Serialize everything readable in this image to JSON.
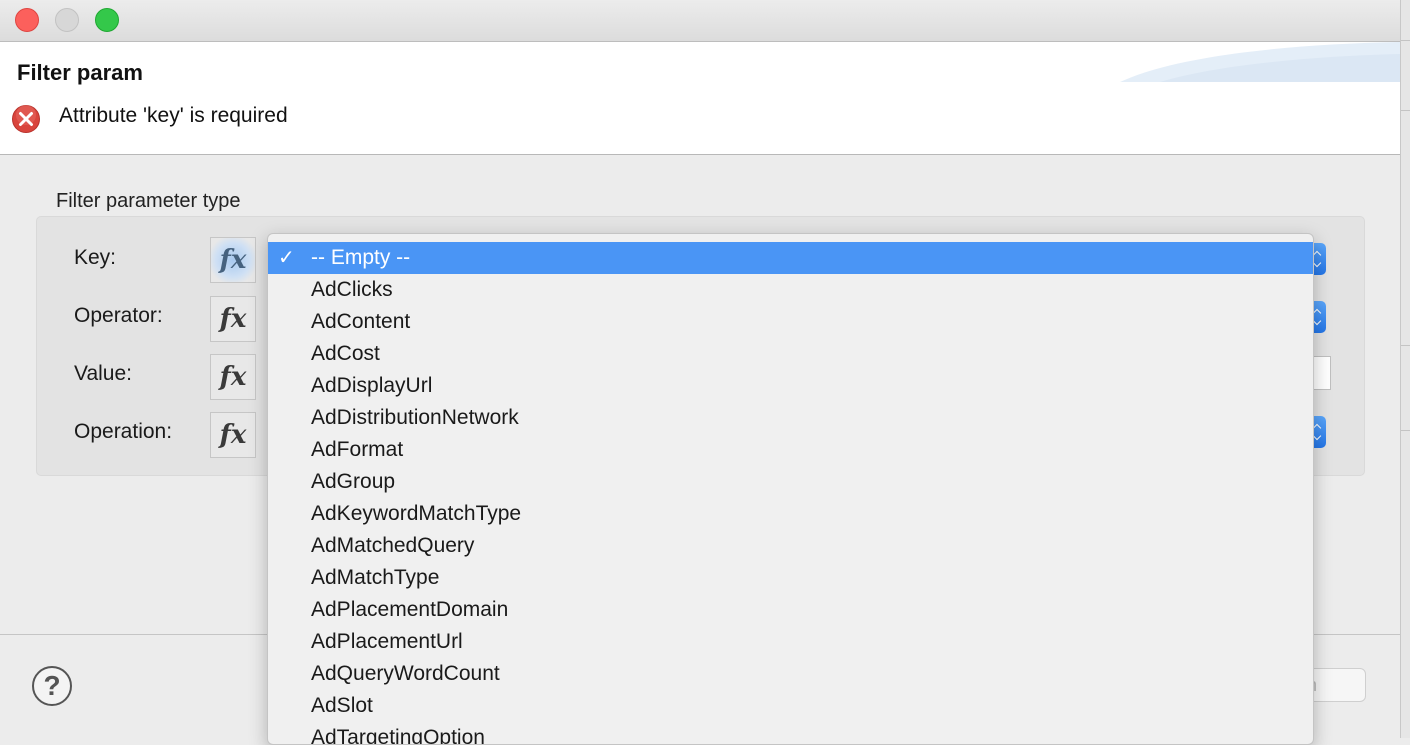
{
  "window": {
    "title": "Filter param",
    "error_message": "Attribute 'key' is required"
  },
  "group": {
    "label": "Filter parameter type",
    "rows": [
      {
        "label": "Key:",
        "fx": "fx"
      },
      {
        "label": "Operator:",
        "fx": "fx"
      },
      {
        "label": "Value:",
        "fx": "fx"
      },
      {
        "label": "Operation:",
        "fx": "fx"
      }
    ]
  },
  "dropdown": {
    "selected_index": 0,
    "check_mark": "✓",
    "options": [
      "-- Empty --",
      "AdClicks",
      "AdContent",
      "AdCost",
      "AdDisplayUrl",
      "AdDistributionNetwork",
      "AdFormat",
      "AdGroup",
      "AdKeywordMatchType",
      "AdMatchedQuery",
      "AdMatchType",
      "AdPlacementDomain",
      "AdPlacementUrl",
      "AdQueryWordCount",
      "AdSlot",
      "AdTargetingOption"
    ]
  },
  "footer": {
    "help_label": "?",
    "partial_button_label": "n"
  },
  "colors": {
    "selection": "#4a95f5",
    "stepper": "#2476e8",
    "error": "#d9443c"
  },
  "icons": {
    "error": "error-circle-x-icon",
    "help": "help-question-icon",
    "check": "checkmark-icon"
  }
}
